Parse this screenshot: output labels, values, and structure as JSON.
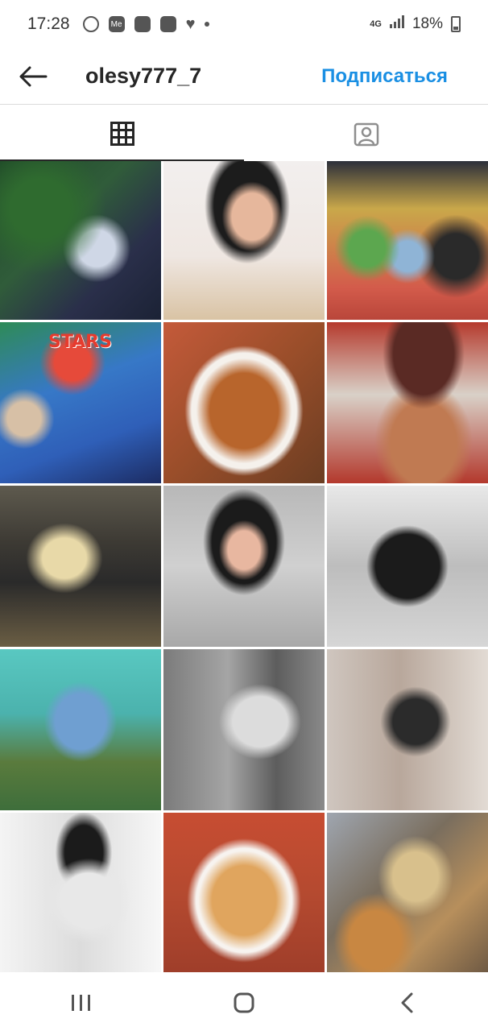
{
  "status_bar": {
    "time": "17:28",
    "network": "4G",
    "battery_percent": "18%",
    "notification_icons": [
      "viber-icon",
      "me-icon",
      "instagram-icon",
      "flipboard-icon",
      "heart-icon"
    ]
  },
  "header": {
    "username": "olesy777_7",
    "follow_label": "Подписаться"
  },
  "tabs": [
    {
      "name": "grid",
      "icon": "grid-icon",
      "active": true
    },
    {
      "name": "tagged",
      "icon": "tagged-person-icon",
      "active": false
    }
  ],
  "posts": [
    {
      "id": "p1"
    },
    {
      "id": "p2"
    },
    {
      "id": "p3"
    },
    {
      "id": "p4"
    },
    {
      "id": "p5"
    },
    {
      "id": "p6"
    },
    {
      "id": "p7"
    },
    {
      "id": "p8"
    },
    {
      "id": "p9"
    },
    {
      "id": "p10"
    },
    {
      "id": "p11"
    },
    {
      "id": "p12"
    },
    {
      "id": "p13"
    },
    {
      "id": "p14"
    },
    {
      "id": "p15"
    }
  ],
  "post4_text": "STARS",
  "nav_bar": {
    "buttons": [
      "recents-icon",
      "home-icon",
      "back-icon"
    ]
  }
}
